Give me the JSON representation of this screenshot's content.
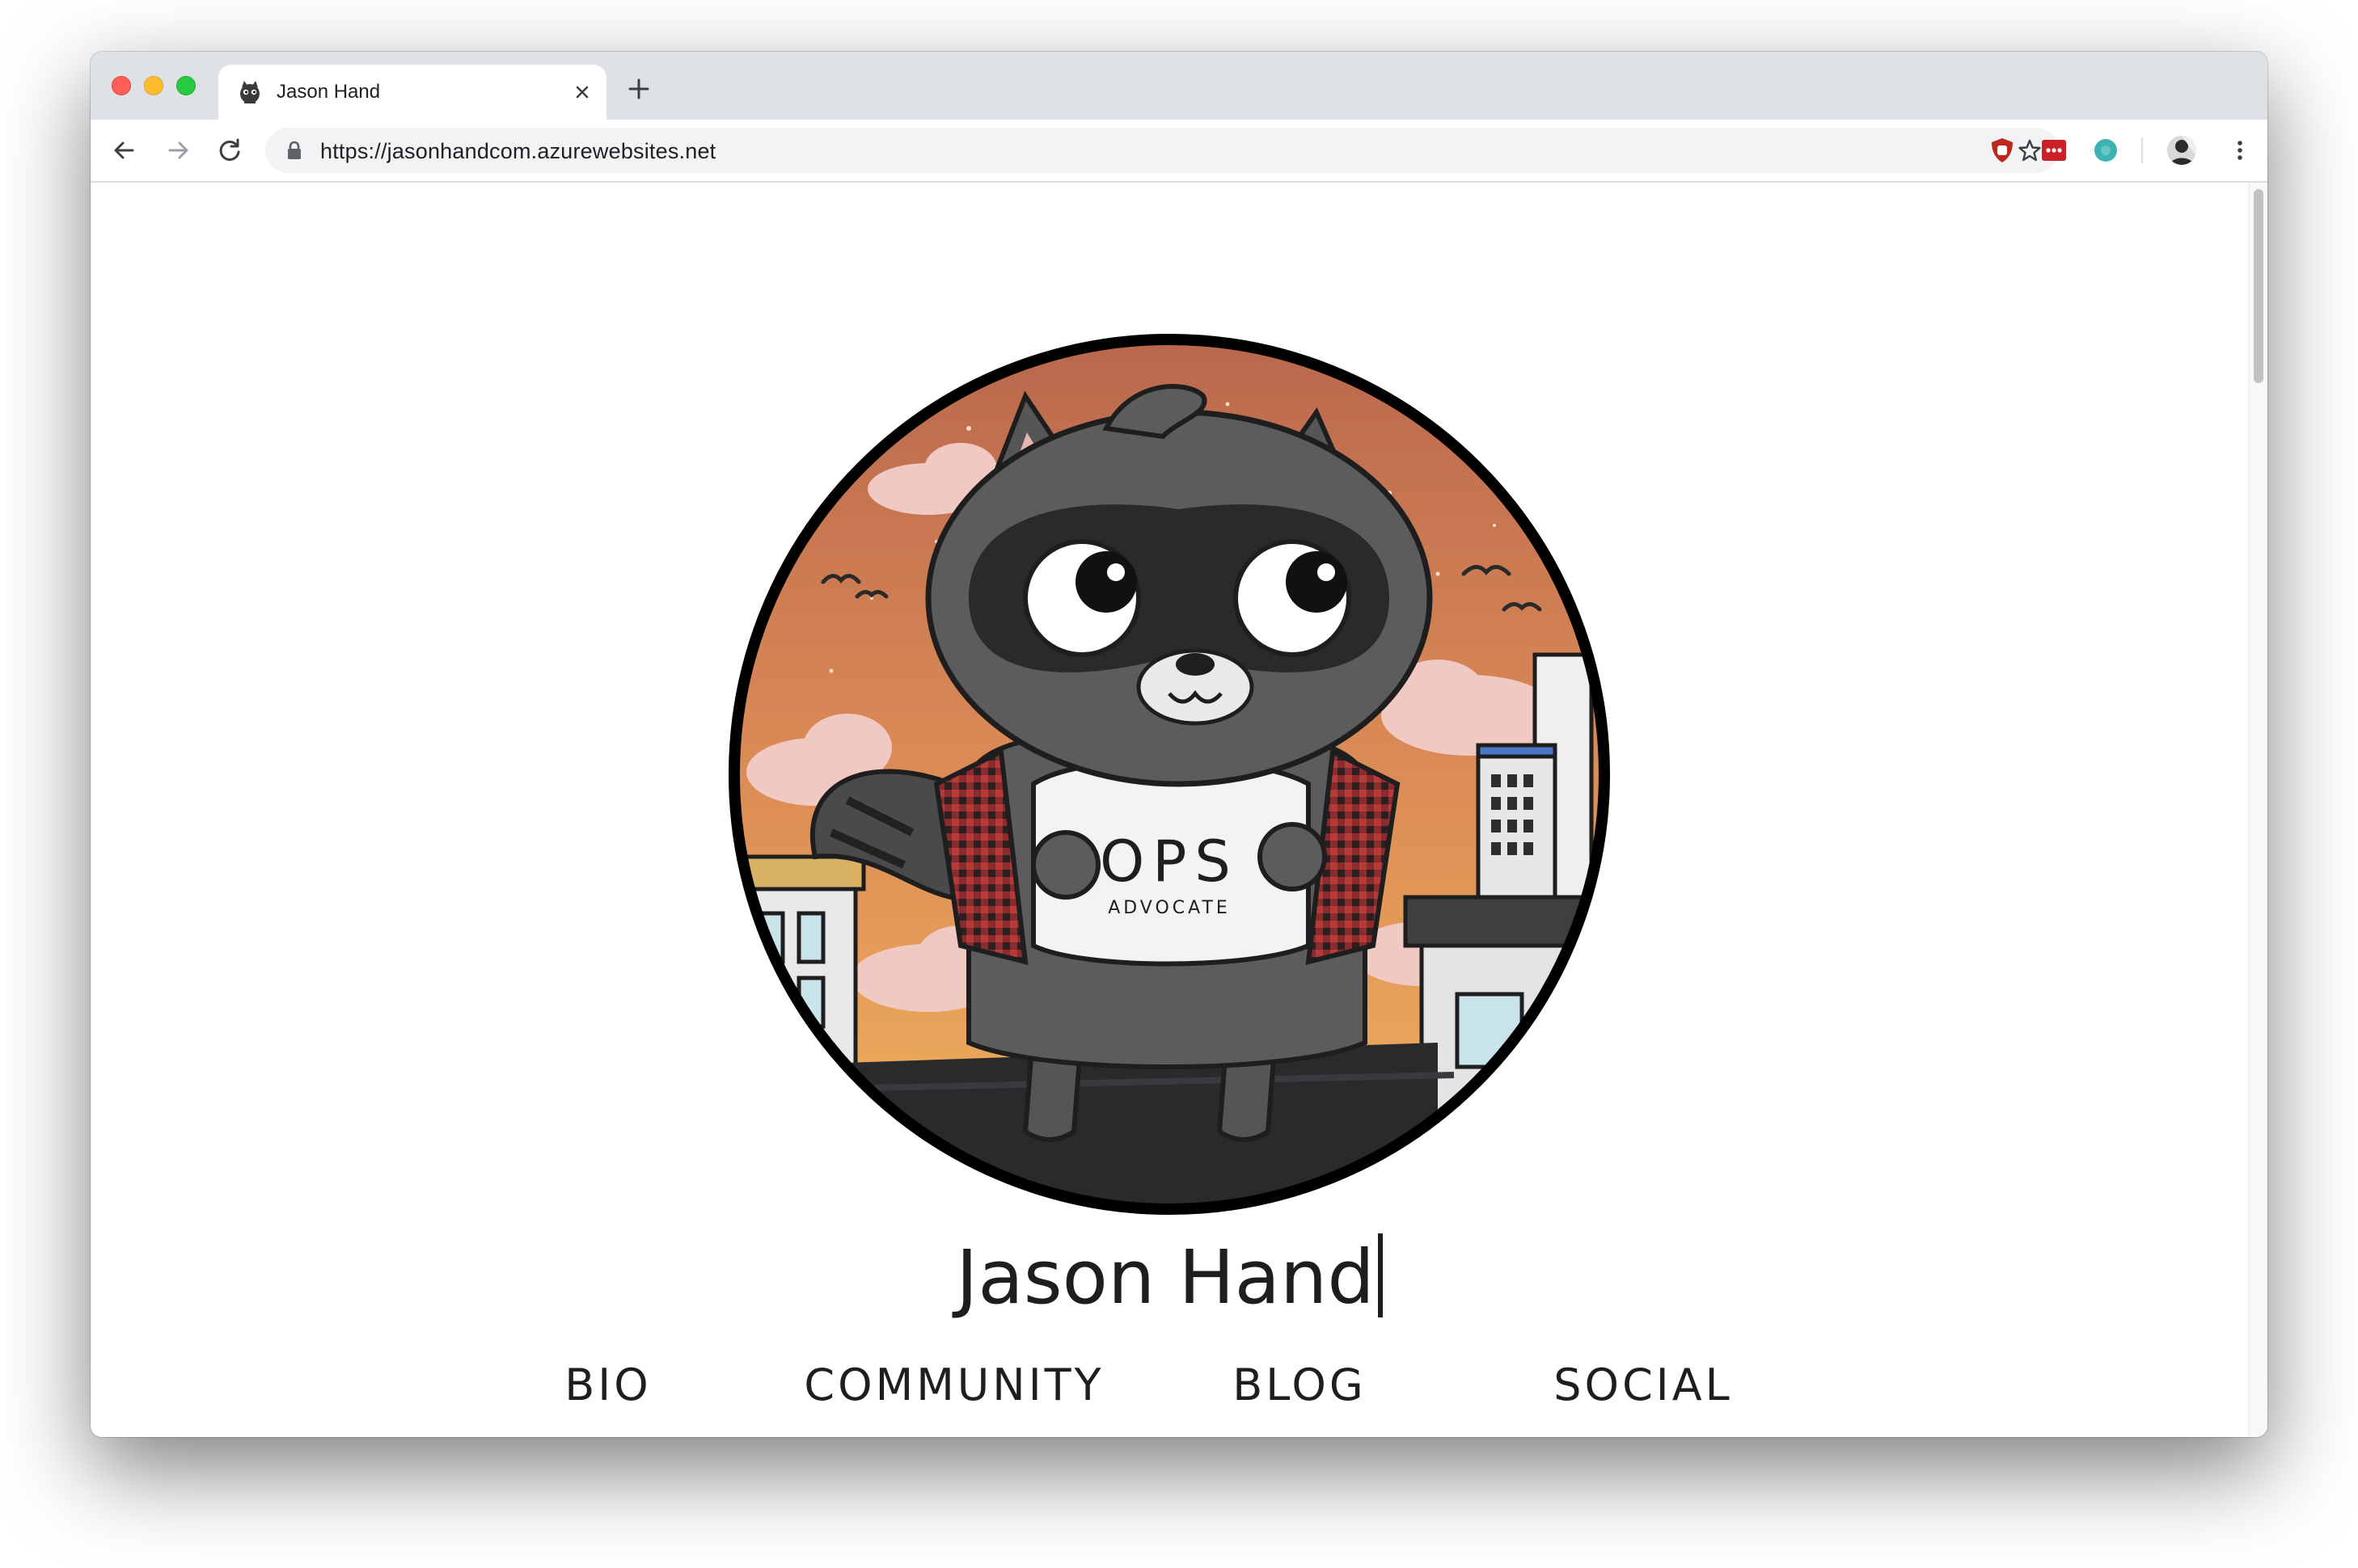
{
  "browser": {
    "tab": {
      "title": "Jason Hand",
      "favicon": "raccoon-favicon-icon"
    },
    "address_bar": {
      "url": "https://jasonhandcom.azurewebsites.net"
    },
    "extensions": [
      "ublock-icon",
      "lastpass-icon",
      "teal-extension-icon"
    ],
    "profile": "profile-avatar"
  },
  "page": {
    "avatar": {
      "shirt_text": "OPS",
      "shirt_subtext": "ADVOCATE"
    },
    "site_name": "Jason Hand",
    "nav": [
      {
        "label": "BIO"
      },
      {
        "label": "COMMUNITY"
      },
      {
        "label": "BLOG"
      },
      {
        "label": "SOCIAL"
      }
    ]
  },
  "colors": {
    "sky_top": "#c9714f",
    "sky_bottom": "#eba95a",
    "raccoon_fur": "#5c5c5e",
    "text": "#1e1e1e"
  }
}
